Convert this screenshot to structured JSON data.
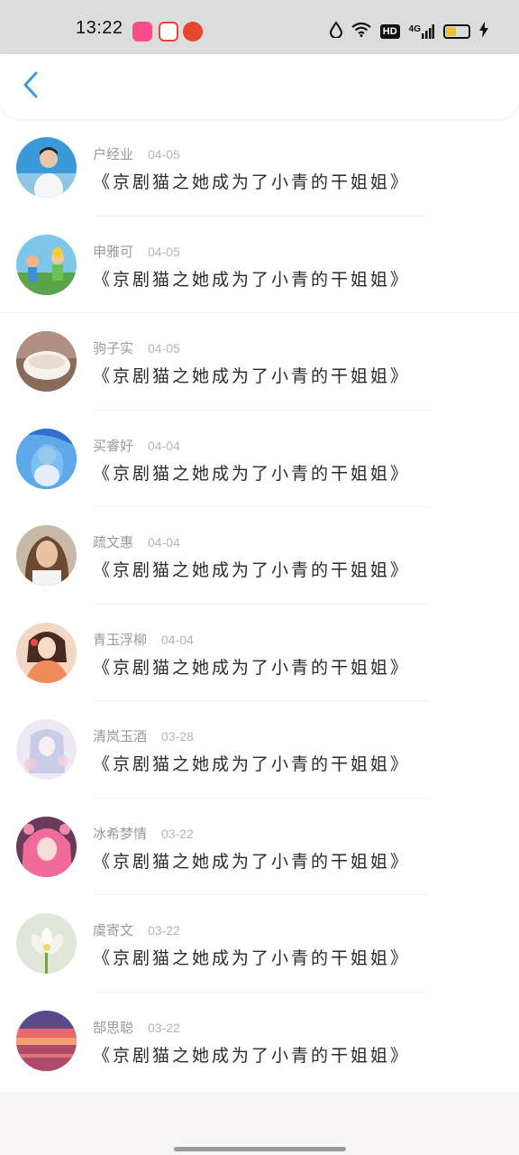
{
  "status_bar": {
    "time": "13:22",
    "network": "4G",
    "hd": "HD"
  },
  "header": {
    "back_icon": "chevron-left-icon",
    "accent_color": "#3a9be0"
  },
  "items": [
    {
      "name": "户经业",
      "date": "04-05",
      "title": "《京剧猫之她成为了小青的干姐姐》"
    },
    {
      "name": "申雅可",
      "date": "04-05",
      "title": "《京剧猫之她成为了小青的干姐姐》"
    },
    {
      "name": "驹子实",
      "date": "04-05",
      "title": "《京剧猫之她成为了小青的干姐姐》"
    },
    {
      "name": "买睿好",
      "date": "04-04",
      "title": "《京剧猫之她成为了小青的干姐姐》"
    },
    {
      "name": "疏文惠",
      "date": "04-04",
      "title": "《京剧猫之她成为了小青的干姐姐》"
    },
    {
      "name": "青玉浮柳",
      "date": "04-04",
      "title": "《京剧猫之她成为了小青的干姐姐》"
    },
    {
      "name": "清岚玉酒",
      "date": "03-28",
      "title": "《京剧猫之她成为了小青的干姐姐》"
    },
    {
      "name": "冰希梦情",
      "date": "03-22",
      "title": "《京剧猫之她成为了小青的干姐姐》"
    },
    {
      "name": "虞寄文",
      "date": "03-22",
      "title": "《京剧猫之她成为了小青的干姐姐》"
    },
    {
      "name": "郜思聪",
      "date": "03-22",
      "title": "《京剧猫之她成为了小青的干姐姐》"
    }
  ]
}
